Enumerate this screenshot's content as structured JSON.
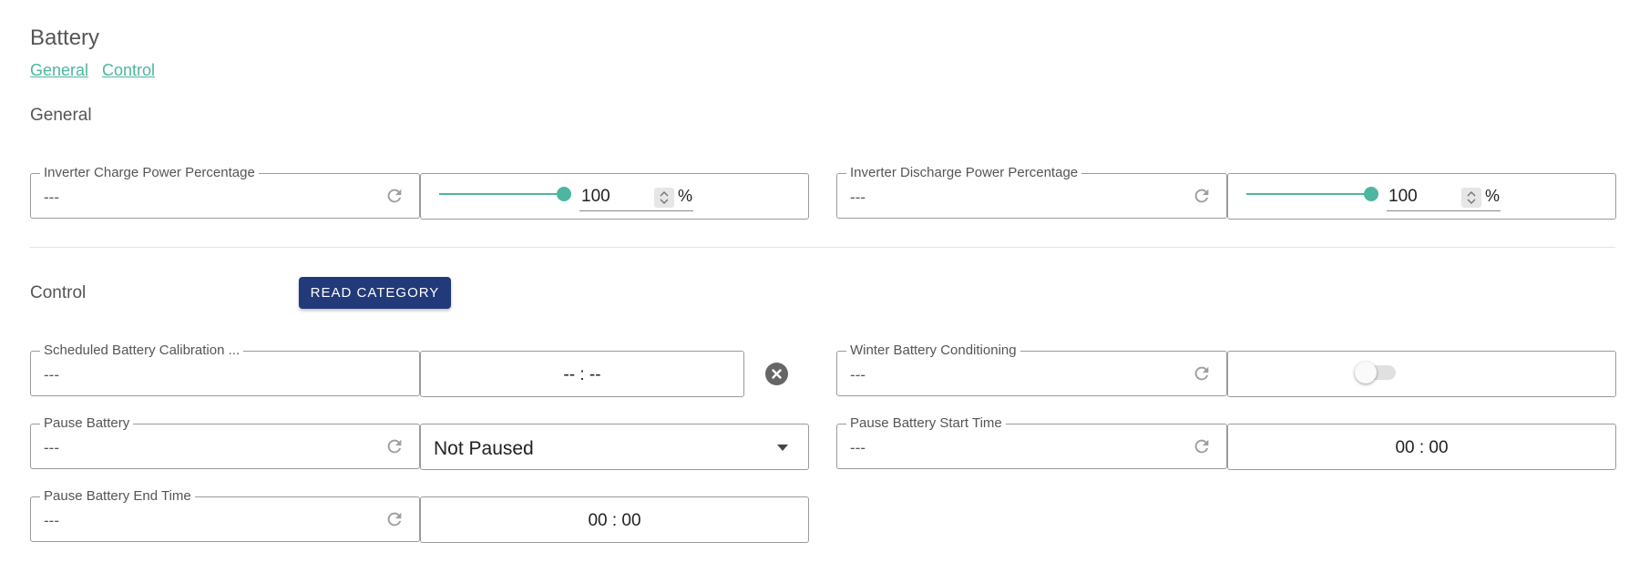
{
  "page": {
    "title": "Battery"
  },
  "anchors": [
    {
      "label": "General"
    },
    {
      "label": "Control"
    }
  ],
  "sections": {
    "general": {
      "title": "General"
    },
    "control": {
      "title": "Control",
      "read_button": "READ CATEGORY"
    }
  },
  "general": {
    "charge": {
      "label": "Inverter Charge Power Percentage",
      "value": "---",
      "slider_fraction": 1.0,
      "input_value": "100",
      "unit": "%",
      "icon": "refresh-icon"
    },
    "discharge": {
      "label": "Inverter Discharge Power Percentage",
      "value": "---",
      "slider_fraction": 1.0,
      "input_value": "100",
      "unit": "%",
      "icon": "refresh-icon"
    }
  },
  "control": {
    "calibration": {
      "label": "Scheduled Battery Calibration ...",
      "value": "---",
      "time_value": "-- : --",
      "clear_icon": "close-circle-icon"
    },
    "winter": {
      "label": "Winter Battery Conditioning",
      "value": "---",
      "toggle_on": false
    },
    "pause": {
      "label": "Pause Battery",
      "value": "---",
      "select_value": "Not Paused"
    },
    "pause_start": {
      "label": "Pause Battery Start Time",
      "value": "---",
      "time_value": "00 : 00"
    },
    "pause_end": {
      "label": "Pause Battery End Time",
      "value": "---",
      "time_value": "00 : 00"
    }
  },
  "colors": {
    "accent": "#4db6a0",
    "button": "#22397a",
    "border": "#9a9a9a"
  }
}
